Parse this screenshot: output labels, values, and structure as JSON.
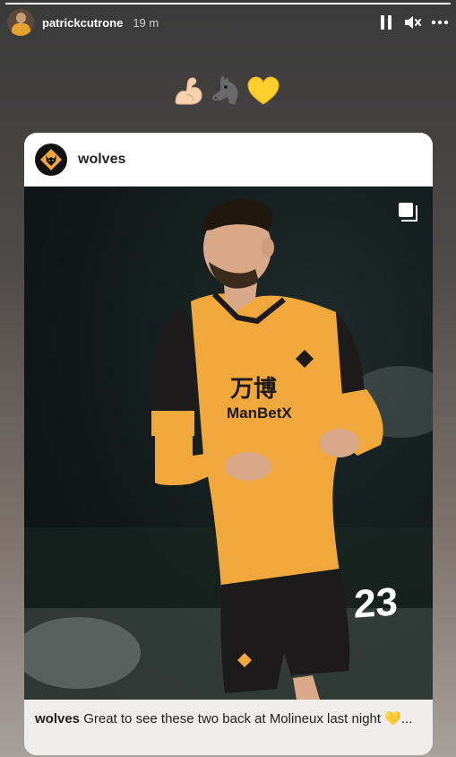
{
  "story": {
    "progress_pct": 100,
    "username": "patrickcutrone",
    "time_ago": "19 m"
  },
  "controls": {
    "pause_icon": "pause-icon",
    "mute_icon": "muted-speaker-icon",
    "more_icon": "more-dots-icon"
  },
  "emojis": [
    "flexed-biceps",
    "horse-head",
    "yellow-heart"
  ],
  "post": {
    "account": "wolves",
    "caption_user": "wolves",
    "caption_text": "Great to see these two back at Molineux last night 💛...",
    "jersey_sponsor_cn": "万博",
    "jersey_sponsor": "ManBetX",
    "jersey_number": "23"
  },
  "colors": {
    "kit": "#f0a83c",
    "kit_dark": "#1c1a1a",
    "caption_bg": "#efedeb"
  }
}
